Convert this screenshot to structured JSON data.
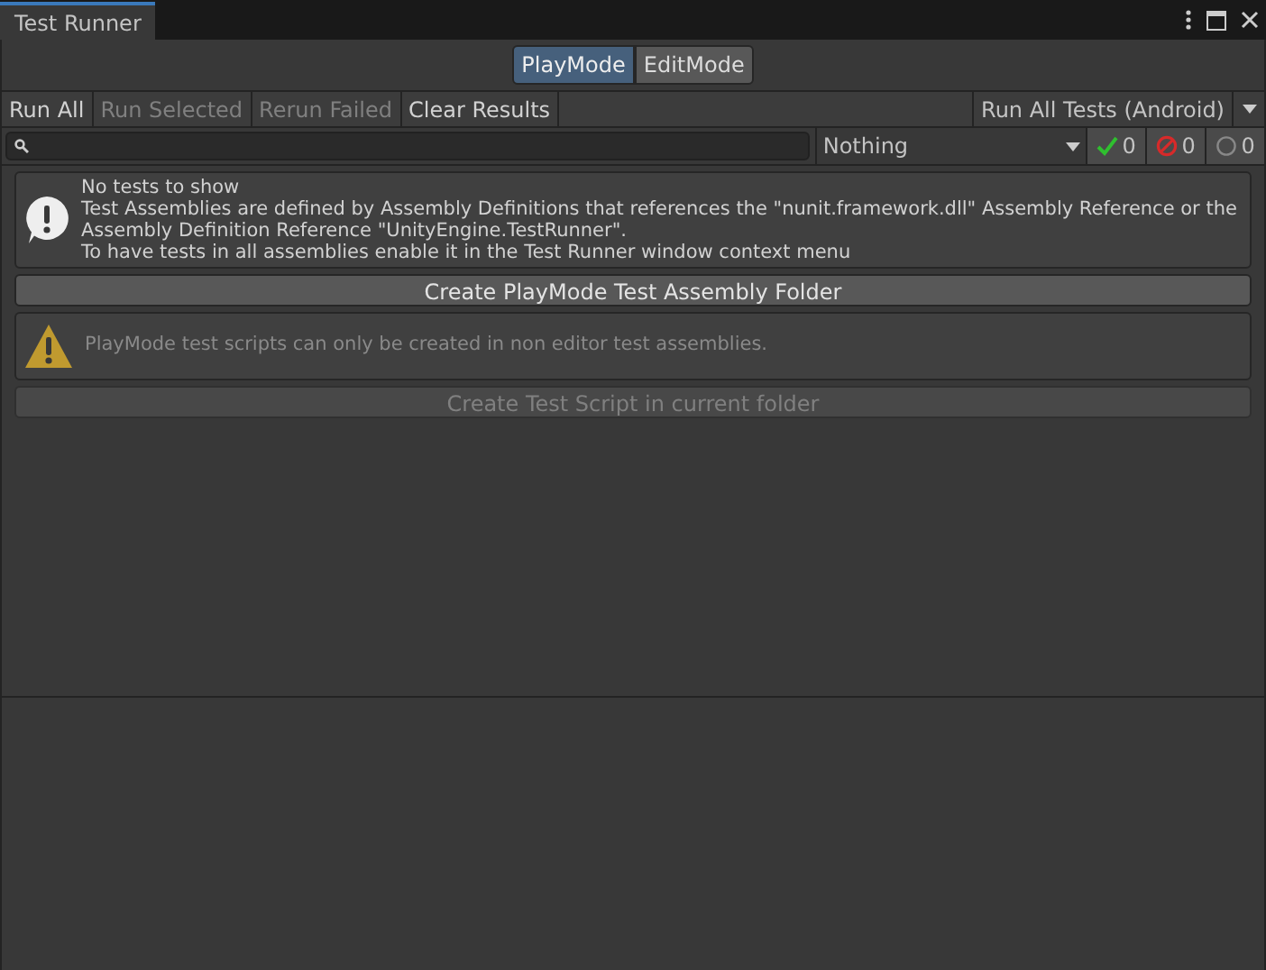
{
  "window": {
    "title": "Test Runner"
  },
  "mode_tabs": [
    {
      "label": "PlayMode",
      "selected": true
    },
    {
      "label": "EditMode",
      "selected": false
    }
  ],
  "toolbar": {
    "buttons": [
      {
        "label": "Run All",
        "disabled": false
      },
      {
        "label": "Run Selected",
        "disabled": true
      },
      {
        "label": "Rerun Failed",
        "disabled": true
      },
      {
        "label": "Clear Results",
        "disabled": false
      }
    ],
    "run_dropdown": "Run All Tests (Android)"
  },
  "filter": {
    "category": "Nothing",
    "counters": [
      {
        "kind": "passed",
        "count": "0"
      },
      {
        "kind": "failed",
        "count": "0"
      },
      {
        "kind": "notrun",
        "count": "0"
      }
    ]
  },
  "info": {
    "lines": [
      "No tests to show",
      "Test Assemblies are defined by Assembly Definitions that references the \"nunit.framework.dll\" Assembly Reference or the Assembly Definition Reference \"UnityEngine.TestRunner\".",
      "To have tests in all assemblies enable it in the Test Runner window context menu"
    ]
  },
  "create_folder_button": {
    "label": "Create PlayMode Test Assembly Folder",
    "disabled": false
  },
  "warning": {
    "text": "PlayMode test scripts can only be created in non editor test assemblies."
  },
  "create_script_button": {
    "label": "Create Test Script in current folder",
    "disabled": true
  }
}
